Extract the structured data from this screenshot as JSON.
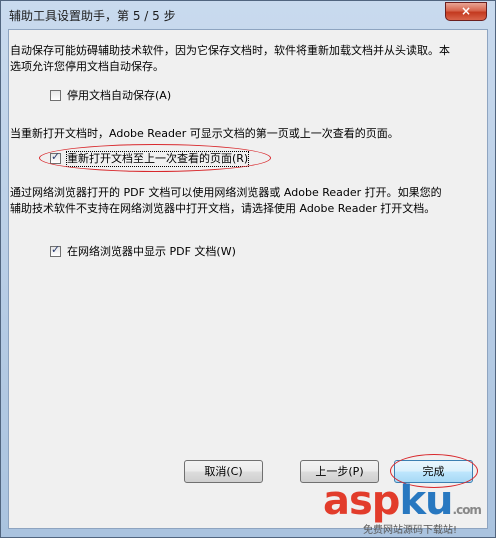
{
  "window": {
    "title": "辅助工具设置助手，第 5 / 5 步",
    "close_glyph": "×"
  },
  "content": {
    "para1": "自动保存可能妨碍辅助技术软件，因为它保存文档时，软件将重新加载文档并从头读取。本选项允许您停用文档自动保存。",
    "cb_disable_autosave": {
      "label": "停用文档自动保存(A)",
      "checked": false
    },
    "para2": "当重新打开文档时，Adobe Reader 可显示文档的第一页或上一次查看的页面。",
    "cb_reopen_last_page": {
      "label": "重新打开文档至上一次查看的页面(R)",
      "checked": true
    },
    "para3": "通过网络浏览器打开的 PDF 文档可以使用网络浏览器或 Adobe Reader 打开。如果您的辅助技术软件不支持在网络浏览器中打开文档，请选择使用 Adobe Reader 打开文档。",
    "cb_show_pdf_in_browser": {
      "label": "在网络浏览器中显示 PDF 文档(W)",
      "checked": true
    }
  },
  "buttons": {
    "cancel": "取消(C)",
    "back": "上一步(P)",
    "finish": "完成"
  },
  "watermark": {
    "brand_a": "asp",
    "brand_b": "ku",
    "suffix": ".com",
    "subtitle": "免费网站源码下载站!"
  },
  "colors": {
    "annotation_red": "#d8282c",
    "check_blue": "#2d3e70"
  }
}
